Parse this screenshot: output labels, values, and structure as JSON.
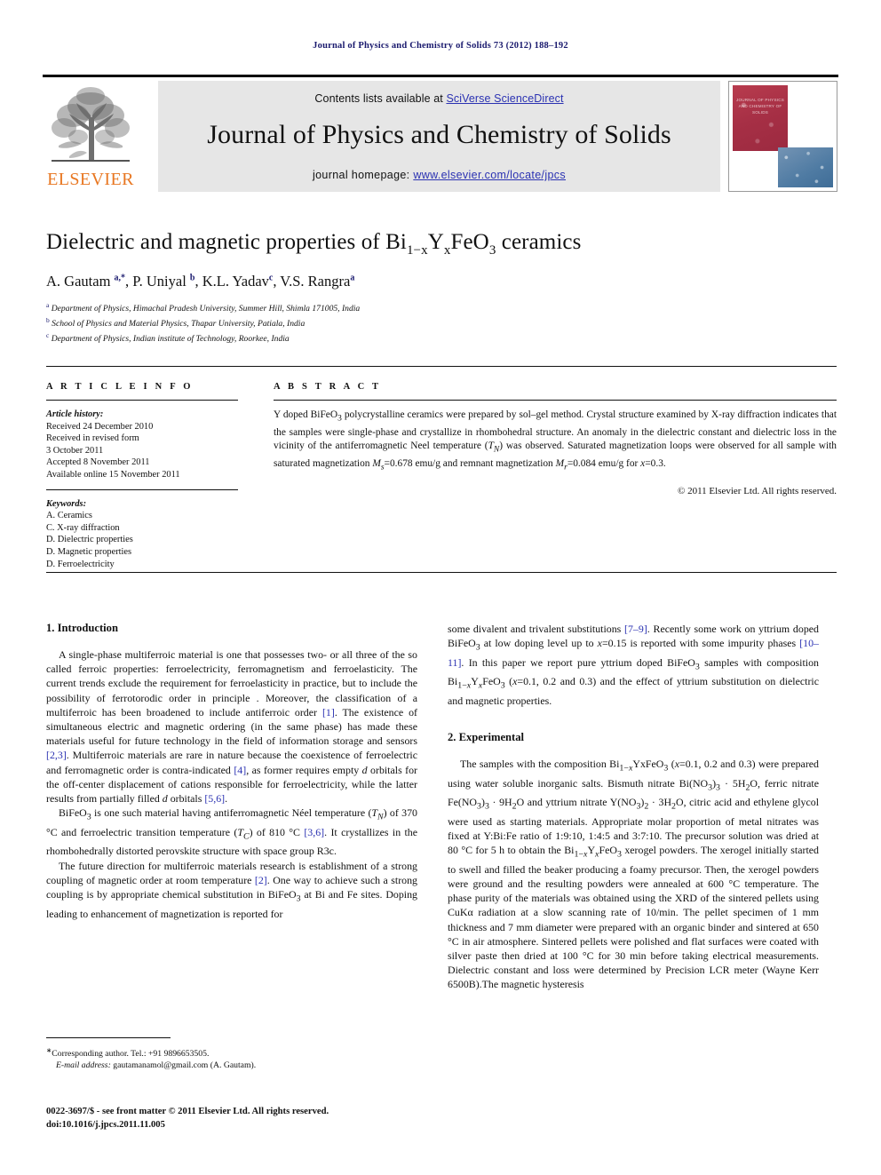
{
  "running_head": "Journal of Physics and Chemistry of Solids 73 (2012) 188–192",
  "masthead": {
    "contents_prefix": "Contents lists available at ",
    "contents_link": "SciVerse ScienceDirect",
    "journal_name": "Journal of Physics and Chemistry of Solids",
    "homepage_prefix": "journal homepage: ",
    "homepage_link": "www.elsevier.com/locate/jpcs",
    "publisher_logo_text": "ELSEVIER",
    "cover_text": "JOURNAL OF PHYSICS AND CHEMISTRY OF SOLIDS",
    "link_color": "#2b32b2",
    "logo_color": "#E87722"
  },
  "title": {
    "prefix": "Dielectric and magnetic properties of Bi",
    "sub1": "1−x",
    "mid": "Y",
    "sub2": "x",
    "mid2": "FeO",
    "sub3": "3",
    "suffix": " ceramics"
  },
  "authors": {
    "list": "A. Gautam a,*, P. Uniyal b, K.L. Yadav c, V.S. Rangra a",
    "affiliations": [
      "a Department of Physics, Himachal Pradesh University, Summer Hill, Shimla 171005, India",
      "b School of Physics and Material Physics, Thapar University, Patiala, India",
      "c Department of Physics, Indian institute of Technology, Roorkee, India"
    ]
  },
  "article_info": {
    "heading": "A R T I C L E  I N F O",
    "history_label": "Article history:",
    "history": [
      "Received 24 December 2010",
      "Received in revised form",
      "3 October 2011",
      "Accepted 8 November 2011",
      "Available online 15 November 2011"
    ],
    "keywords_label": "Keywords:",
    "keywords": [
      "A. Ceramics",
      "C. X-ray diffraction",
      "D. Dielectric properties",
      "D. Magnetic properties",
      "D. Ferroelectricity"
    ]
  },
  "abstract": {
    "heading": "A B S T R A C T",
    "text": "Y doped BiFeO3 polycrystalline ceramics were prepared by sol–gel method. Crystal structure examined by X-ray diffraction indicates that the samples were single-phase and crystallize in rhombohedral structure. An anomaly in the dielectric constant and dielectric loss in the vicinity of the antiferromagnetic Neel temperature (TN) was observed. Saturated magnetization loops were observed for all sample with saturated magnetization Ms=0.678 emu/g and remnant magnetization Mr=0.084 emu/g for x=0.3.",
    "copyright": "© 2011 Elsevier Ltd. All rights reserved."
  },
  "sections": {
    "introduction_heading": "1.  Introduction",
    "experimental_heading": "2.  Experimental"
  },
  "body": {
    "intro_p1": "A single-phase multiferroic material is one that possesses two- or all three of the so called ferroic properties: ferroelectricity, ferromagnetism and ferroelasticity. The current trends exclude the requirement for ferroelasticity in practice, but to include the possibility of ferrotorodic order in principle . Moreover, the classification of a multiferroic has been broadened to include antiferroic order [1]. The existence of simultaneous electric and magnetic ordering (in the same phase) has made these materials useful for future technology in the field of information storage and sensors [2,3]. Multiferroic materials are rare in nature because the coexistence of ferroelectric and ferromagnetic order is contra-indicated [4], as former requires empty d orbitals for the off-center displacement of cations responsible for ferroelectricity, while the latter results from partially filled d orbitals [5,6].",
    "intro_p2": "BiFeO3 is one such material having antiferromagnetic Néel temperature (TN) of 370 °C and ferroelectric transition temperature (TC) of 810 °C [3,6]. It crystallizes in the rhombohedrally distorted perovskite structure with space group R3c.",
    "intro_p3": "The future direction for multiferroic materials research is establishment of a strong coupling of magnetic order at room temperature [2]. One way to achieve such a strong coupling is by appropriate chemical substitution in BiFeO3 at Bi and Fe sites. Doping leading to enhancement of magnetization is reported for",
    "intro_p4": "some divalent and trivalent substitutions [7–9]. Recently some work on yttrium doped BiFeO3 at low doping level up to x=0.15 is reported with some impurity phases [10–11]. In this paper we report pure yttrium doped BiFeO3 samples with composition Bi1−xYxFeO3 (x=0.1, 0.2 and 0.3) and the effect of yttrium substitution on dielectric and magnetic properties.",
    "exp_p1": "The samples with the composition Bi1−xYxFeO3 (x=0.1, 0.2 and 0.3) were prepared using water soluble inorganic salts. Bismuth nitrate Bi(NO3)3 · 5H2O, ferric nitrate Fe(NO3)3 · 9H2O and yttrium nitrate Y(NO3)2 · 3H2O, citric acid and ethylene glycol were used as starting materials. Appropriate molar proportion of metal nitrates was fixed at Y:Bi:Fe ratio of 1:9:10, 1:4:5 and 3:7:10. The precursor solution was dried at 80 °C for 5 h to obtain the Bi1−xYxFeO3 xerogel powders. The xerogel initially started to swell and filled the beaker producing a foamy precursor. Then, the xerogel powders were ground and the resulting powders were annealed at 600 °C temperature. The phase purity of the materials was obtained using the XRD of the sintered pellets using CuKα radiation at a slow scanning rate of 10/min. The pellet specimen of 1 mm thickness and 7 mm diameter were prepared with an organic binder and sintered at 650 °C in air atmosphere. Sintered pellets were polished and flat surfaces were coated with silver paste then dried at 100 °C for 30 min before taking electrical measurements. Dielectric constant and loss were determined by Precision LCR meter (Wayne Kerr 6500B).The magnetic hysteresis"
  },
  "footnotes": {
    "corresponding": "Corresponding author. Tel.: +91 9896653505.",
    "email_label": "E-mail address:",
    "email": "gautamanamol@gmail.com (A. Gautam).",
    "issn_line": "0022-3697/$ - see front matter © 2011 Elsevier Ltd. All rights reserved.",
    "doi_line": "doi:10.1016/j.jpcs.2011.11.005"
  }
}
